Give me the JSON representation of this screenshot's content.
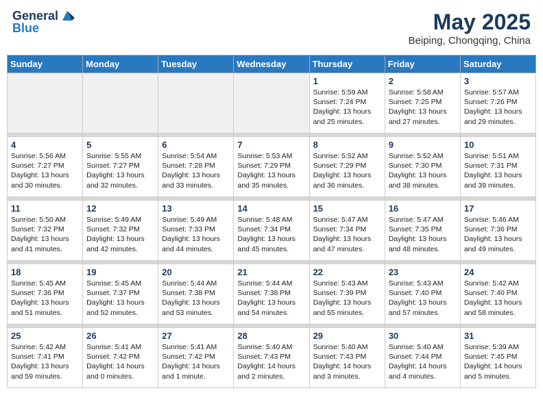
{
  "logo": {
    "line1": "General",
    "line2": "Blue"
  },
  "title": "May 2025",
  "location": "Beiping, Chongqing, China",
  "weekdays": [
    "Sunday",
    "Monday",
    "Tuesday",
    "Wednesday",
    "Thursday",
    "Friday",
    "Saturday"
  ],
  "weeks": [
    [
      {
        "day": "",
        "detail": ""
      },
      {
        "day": "",
        "detail": ""
      },
      {
        "day": "",
        "detail": ""
      },
      {
        "day": "",
        "detail": ""
      },
      {
        "day": "1",
        "detail": "Sunrise: 5:59 AM\nSunset: 7:24 PM\nDaylight: 13 hours\nand 25 minutes."
      },
      {
        "day": "2",
        "detail": "Sunrise: 5:58 AM\nSunset: 7:25 PM\nDaylight: 13 hours\nand 27 minutes."
      },
      {
        "day": "3",
        "detail": "Sunrise: 5:57 AM\nSunset: 7:26 PM\nDaylight: 13 hours\nand 29 minutes."
      }
    ],
    [
      {
        "day": "4",
        "detail": "Sunrise: 5:56 AM\nSunset: 7:27 PM\nDaylight: 13 hours\nand 30 minutes."
      },
      {
        "day": "5",
        "detail": "Sunrise: 5:55 AM\nSunset: 7:27 PM\nDaylight: 13 hours\nand 32 minutes."
      },
      {
        "day": "6",
        "detail": "Sunrise: 5:54 AM\nSunset: 7:28 PM\nDaylight: 13 hours\nand 33 minutes."
      },
      {
        "day": "7",
        "detail": "Sunrise: 5:53 AM\nSunset: 7:29 PM\nDaylight: 13 hours\nand 35 minutes."
      },
      {
        "day": "8",
        "detail": "Sunrise: 5:52 AM\nSunset: 7:29 PM\nDaylight: 13 hours\nand 36 minutes."
      },
      {
        "day": "9",
        "detail": "Sunrise: 5:52 AM\nSunset: 7:30 PM\nDaylight: 13 hours\nand 38 minutes."
      },
      {
        "day": "10",
        "detail": "Sunrise: 5:51 AM\nSunset: 7:31 PM\nDaylight: 13 hours\nand 39 minutes."
      }
    ],
    [
      {
        "day": "11",
        "detail": "Sunrise: 5:50 AM\nSunset: 7:32 PM\nDaylight: 13 hours\nand 41 minutes."
      },
      {
        "day": "12",
        "detail": "Sunrise: 5:49 AM\nSunset: 7:32 PM\nDaylight: 13 hours\nand 42 minutes."
      },
      {
        "day": "13",
        "detail": "Sunrise: 5:49 AM\nSunset: 7:33 PM\nDaylight: 13 hours\nand 44 minutes."
      },
      {
        "day": "14",
        "detail": "Sunrise: 5:48 AM\nSunset: 7:34 PM\nDaylight: 13 hours\nand 45 minutes."
      },
      {
        "day": "15",
        "detail": "Sunrise: 5:47 AM\nSunset: 7:34 PM\nDaylight: 13 hours\nand 47 minutes."
      },
      {
        "day": "16",
        "detail": "Sunrise: 5:47 AM\nSunset: 7:35 PM\nDaylight: 13 hours\nand 48 minutes."
      },
      {
        "day": "17",
        "detail": "Sunrise: 5:46 AM\nSunset: 7:36 PM\nDaylight: 13 hours\nand 49 minutes."
      }
    ],
    [
      {
        "day": "18",
        "detail": "Sunrise: 5:45 AM\nSunset: 7:36 PM\nDaylight: 13 hours\nand 51 minutes."
      },
      {
        "day": "19",
        "detail": "Sunrise: 5:45 AM\nSunset: 7:37 PM\nDaylight: 13 hours\nand 52 minutes."
      },
      {
        "day": "20",
        "detail": "Sunrise: 5:44 AM\nSunset: 7:38 PM\nDaylight: 13 hours\nand 53 minutes."
      },
      {
        "day": "21",
        "detail": "Sunrise: 5:44 AM\nSunset: 7:38 PM\nDaylight: 13 hours\nand 54 minutes."
      },
      {
        "day": "22",
        "detail": "Sunrise: 5:43 AM\nSunset: 7:39 PM\nDaylight: 13 hours\nand 55 minutes."
      },
      {
        "day": "23",
        "detail": "Sunrise: 5:43 AM\nSunset: 7:40 PM\nDaylight: 13 hours\nand 57 minutes."
      },
      {
        "day": "24",
        "detail": "Sunrise: 5:42 AM\nSunset: 7:40 PM\nDaylight: 13 hours\nand 58 minutes."
      }
    ],
    [
      {
        "day": "25",
        "detail": "Sunrise: 5:42 AM\nSunset: 7:41 PM\nDaylight: 13 hours\nand 59 minutes."
      },
      {
        "day": "26",
        "detail": "Sunrise: 5:41 AM\nSunset: 7:42 PM\nDaylight: 14 hours\nand 0 minutes."
      },
      {
        "day": "27",
        "detail": "Sunrise: 5:41 AM\nSunset: 7:42 PM\nDaylight: 14 hours\nand 1 minute."
      },
      {
        "day": "28",
        "detail": "Sunrise: 5:40 AM\nSunset: 7:43 PM\nDaylight: 14 hours\nand 2 minutes."
      },
      {
        "day": "29",
        "detail": "Sunrise: 5:40 AM\nSunset: 7:43 PM\nDaylight: 14 hours\nand 3 minutes."
      },
      {
        "day": "30",
        "detail": "Sunrise: 5:40 AM\nSunset: 7:44 PM\nDaylight: 14 hours\nand 4 minutes."
      },
      {
        "day": "31",
        "detail": "Sunrise: 5:39 AM\nSunset: 7:45 PM\nDaylight: 14 hours\nand 5 minutes."
      }
    ]
  ]
}
